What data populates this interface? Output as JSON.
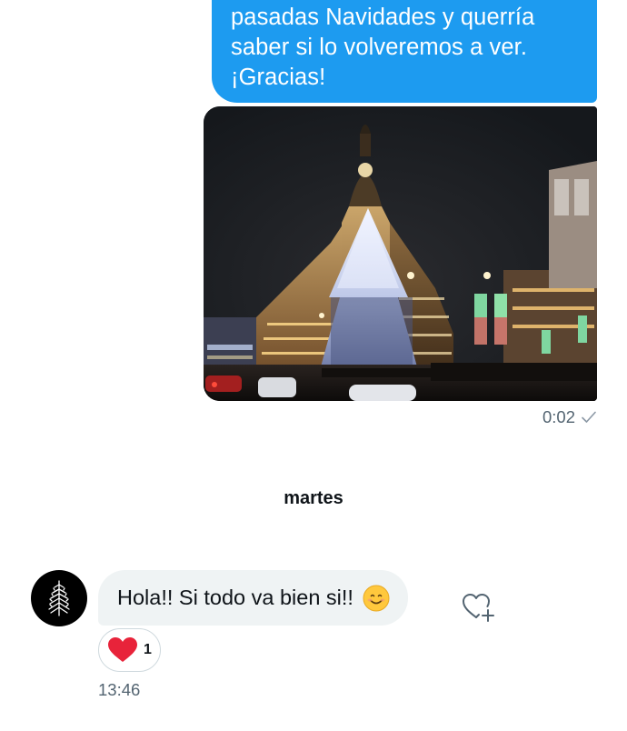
{
  "conversation": {
    "outgoing_message": {
      "lines": [
        "pasadas Navidades y querría",
        "saber si lo volveremos a ver.",
        "¡Gracias!"
      ]
    },
    "photo": {
      "alt": "Edificio iluminado con árbol de Navidad de noche"
    },
    "sent_time": "0:02",
    "day_divider": "martes",
    "incoming_message": {
      "text": "Hola!! Si todo va bien si!!",
      "emoji_icon": "smiling-face-emoji"
    },
    "reaction": {
      "icon": "heart-icon",
      "count": "1"
    },
    "received_time": "13:46"
  },
  "colors": {
    "outgoing_bubble": "#1d9bf0",
    "incoming_bubble": "#eff3f4",
    "secondary_text": "#536471",
    "heart": "#f91880"
  }
}
